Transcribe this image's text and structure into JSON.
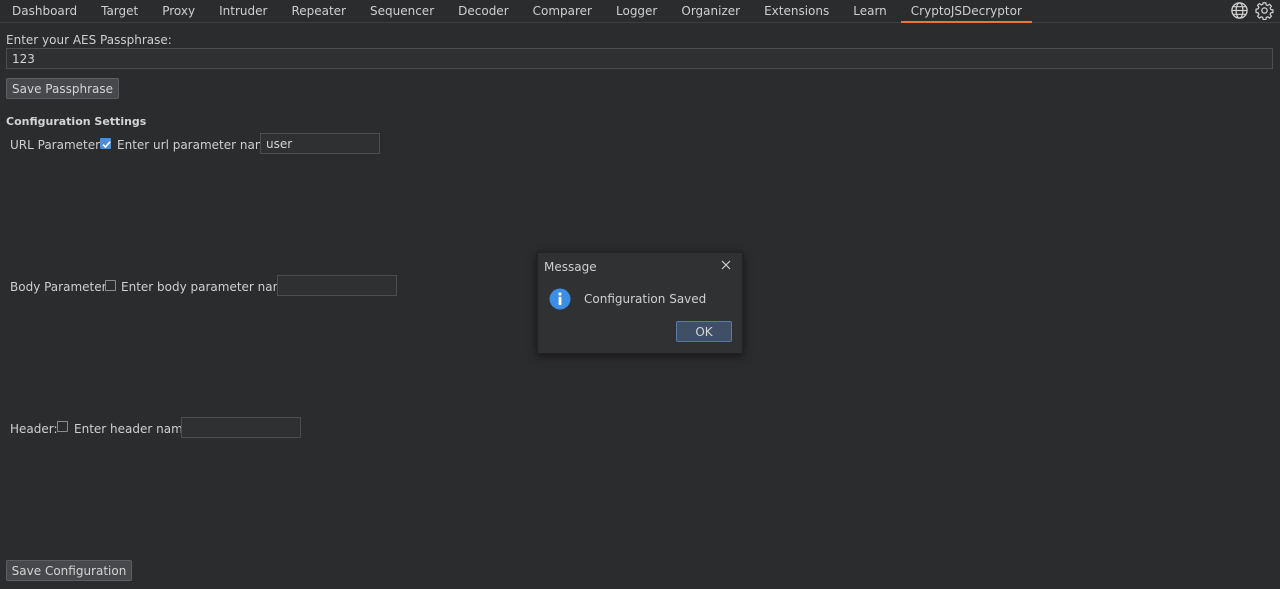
{
  "tabs": [
    {
      "label": "Dashboard"
    },
    {
      "label": "Target"
    },
    {
      "label": "Proxy"
    },
    {
      "label": "Intruder"
    },
    {
      "label": "Repeater"
    },
    {
      "label": "Sequencer"
    },
    {
      "label": "Decoder"
    },
    {
      "label": "Comparer"
    },
    {
      "label": "Logger"
    },
    {
      "label": "Organizer"
    },
    {
      "label": "Extensions"
    },
    {
      "label": "Learn"
    },
    {
      "label": "CryptoJSDecryptor",
      "active": true
    }
  ],
  "toolbar_icons": [
    "globe-icon",
    "gear-icon"
  ],
  "passphrase": {
    "label": "Enter your AES Passphrase:",
    "value": "123",
    "save_label": "Save Passphrase"
  },
  "config": {
    "title": "Configuration Settings",
    "url": {
      "label": "URL Parameter:",
      "checked": true,
      "field_label": "Enter url parameter name:",
      "value": "user"
    },
    "body": {
      "label": "Body Parameter:",
      "checked": false,
      "field_label": "Enter body parameter name:",
      "value": ""
    },
    "header": {
      "label": "Header:",
      "checked": false,
      "field_label": "Enter header name:",
      "value": ""
    },
    "save_label": "Save Configuration"
  },
  "dialog": {
    "title": "Message",
    "icon": "info-icon",
    "message": "Configuration Saved",
    "ok_label": "OK"
  },
  "colors": {
    "background": "#2b2c2e",
    "active_tab_underline": "#e8763a",
    "checkbox_checked": "#4a8edc",
    "info_icon": "#3a8ee6"
  }
}
